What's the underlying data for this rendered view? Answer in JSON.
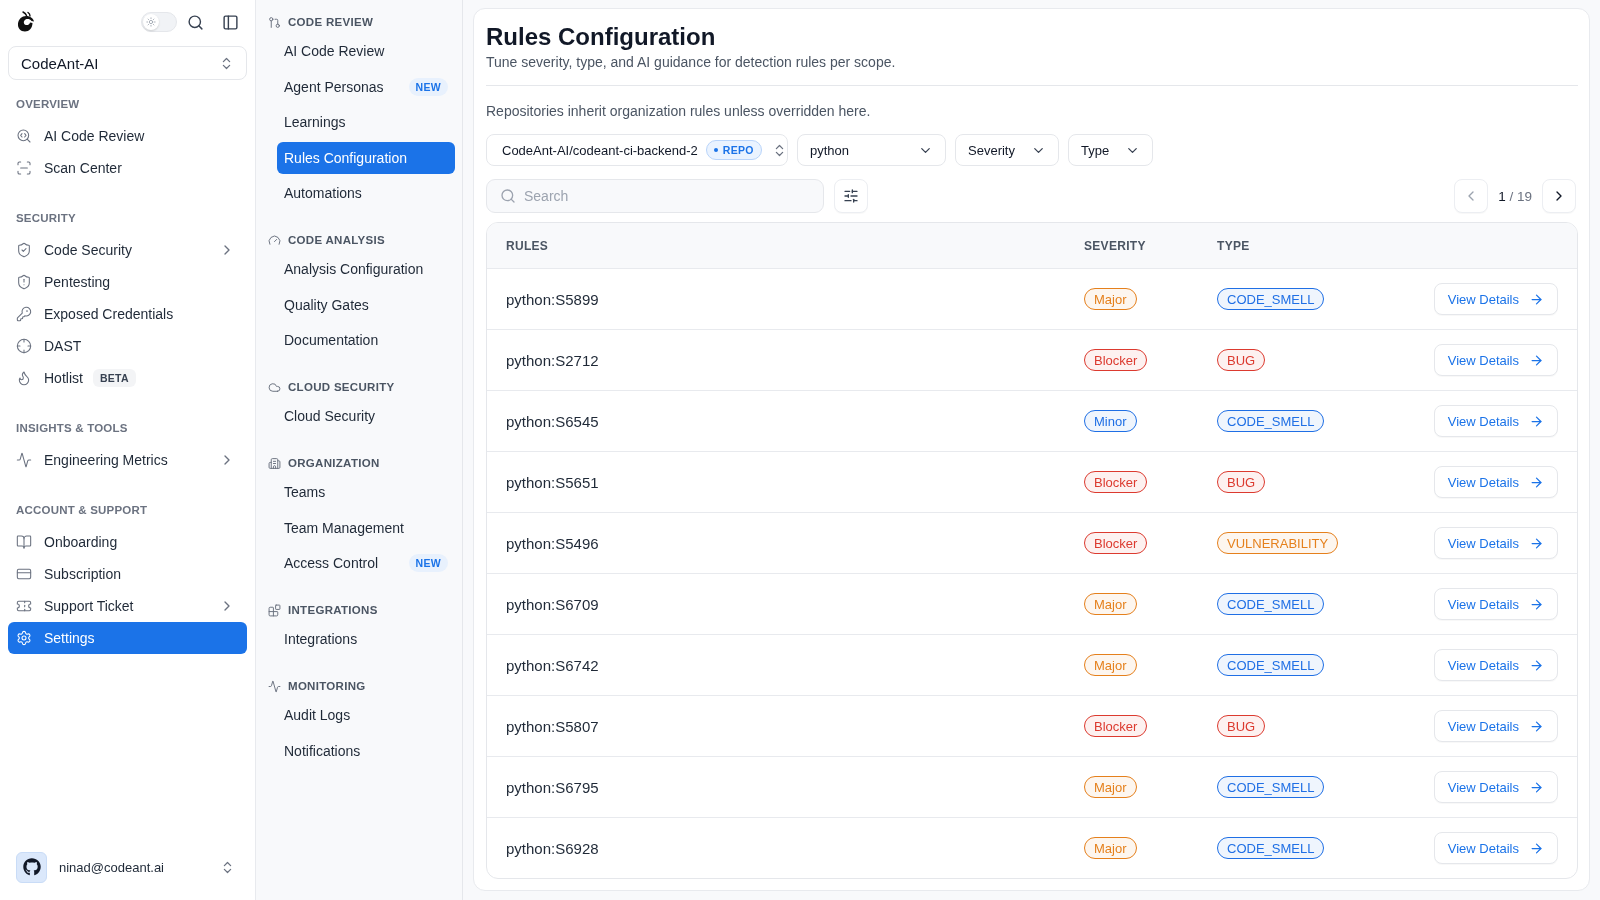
{
  "sidebar": {
    "theme_toggle": {
      "on": false
    },
    "organization": "CodeAnt-AI",
    "sections": [
      {
        "title": "OVERVIEW",
        "items": [
          {
            "label": "AI Code Review",
            "selected": false,
            "expandable": false
          },
          {
            "label": "Scan Center",
            "selected": false,
            "expandable": false
          }
        ]
      },
      {
        "title": "SECURITY",
        "items": [
          {
            "label": "Code Security",
            "selected": false,
            "expandable": true
          },
          {
            "label": "Pentesting",
            "selected": false,
            "expandable": false
          },
          {
            "label": "Exposed Credentials",
            "selected": false,
            "expandable": false
          },
          {
            "label": "DAST",
            "selected": false,
            "expandable": false
          },
          {
            "label": "Hotlist",
            "selected": false,
            "expandable": false,
            "badge": "BETA"
          }
        ]
      },
      {
        "title": "INSIGHTS & TOOLS",
        "items": [
          {
            "label": "Engineering Metrics",
            "selected": false,
            "expandable": true
          }
        ]
      },
      {
        "title": "ACCOUNT & SUPPORT",
        "items": [
          {
            "label": "Onboarding",
            "selected": false,
            "expandable": false
          },
          {
            "label": "Subscription",
            "selected": false,
            "expandable": false
          },
          {
            "label": "Support Ticket",
            "selected": false,
            "expandable": true
          },
          {
            "label": "Settings",
            "selected": true,
            "expandable": false
          }
        ]
      }
    ],
    "user": {
      "email": "ninad@codeant.ai"
    }
  },
  "settings_nav": {
    "sections": [
      {
        "title": "CODE REVIEW",
        "items": [
          {
            "label": "AI Code Review",
            "selected": false
          },
          {
            "label": "Agent Personas",
            "selected": false,
            "badge": "NEW"
          },
          {
            "label": "Learnings",
            "selected": false
          },
          {
            "label": "Rules Configuration",
            "selected": true
          },
          {
            "label": "Automations",
            "selected": false
          }
        ]
      },
      {
        "title": "CODE ANALYSIS",
        "items": [
          {
            "label": "Analysis Configuration",
            "selected": false
          },
          {
            "label": "Quality Gates",
            "selected": false
          },
          {
            "label": "Documentation",
            "selected": false
          }
        ]
      },
      {
        "title": "CLOUD SECURITY",
        "items": [
          {
            "label": "Cloud Security",
            "selected": false
          }
        ]
      },
      {
        "title": "ORGANIZATION",
        "items": [
          {
            "label": "Teams",
            "selected": false
          },
          {
            "label": "Team Management",
            "selected": false
          },
          {
            "label": "Access Control",
            "selected": false,
            "badge": "NEW"
          }
        ]
      },
      {
        "title": "INTEGRATIONS",
        "items": [
          {
            "label": "Integrations",
            "selected": false
          }
        ]
      },
      {
        "title": "MONITORING",
        "items": [
          {
            "label": "Audit Logs",
            "selected": false
          },
          {
            "label": "Notifications",
            "selected": false
          }
        ]
      }
    ]
  },
  "page": {
    "title": "Rules Configuration",
    "subtitle": "Tune severity, type, and AI guidance for detection rules per scope.",
    "note": "Repositories inherit organization rules unless overridden here.",
    "repository": {
      "value": "CodeAnt-AI/codeant-ci-backend-2",
      "badge": "REPO"
    },
    "filters": [
      {
        "label": "python"
      },
      {
        "label": "Severity"
      },
      {
        "label": "Type"
      }
    ],
    "search": {
      "placeholder": "Search"
    },
    "pagination": {
      "current": "1",
      "total": "/ 19",
      "prev_disabled": true
    },
    "table": {
      "columns": [
        "RULES",
        "SEVERITY",
        "TYPE"
      ],
      "rows": [
        {
          "rule": "python:S5899",
          "severity": {
            "label": "Major",
            "color": "#e5801c"
          },
          "type": {
            "label": "CODE_SMELL",
            "color": "#1f6fe5"
          },
          "action": "View Details"
        },
        {
          "rule": "python:S2712",
          "severity": {
            "label": "Blocker",
            "color": "#dc3a2f"
          },
          "type": {
            "label": "BUG",
            "color": "#dc3a2f"
          },
          "action": "View Details"
        },
        {
          "rule": "python:S6545",
          "severity": {
            "label": "Minor",
            "color": "#1f6fe5"
          },
          "type": {
            "label": "CODE_SMELL",
            "color": "#1f6fe5"
          },
          "action": "View Details"
        },
        {
          "rule": "python:S5651",
          "severity": {
            "label": "Blocker",
            "color": "#dc3a2f"
          },
          "type": {
            "label": "BUG",
            "color": "#dc3a2f"
          },
          "action": "View Details"
        },
        {
          "rule": "python:S5496",
          "severity": {
            "label": "Blocker",
            "color": "#dc3a2f"
          },
          "type": {
            "label": "VULNERABILITY",
            "color": "#e5801c"
          },
          "action": "View Details"
        },
        {
          "rule": "python:S6709",
          "severity": {
            "label": "Major",
            "color": "#e5801c"
          },
          "type": {
            "label": "CODE_SMELL",
            "color": "#1f6fe5"
          },
          "action": "View Details"
        },
        {
          "rule": "python:S6742",
          "severity": {
            "label": "Major",
            "color": "#e5801c"
          },
          "type": {
            "label": "CODE_SMELL",
            "color": "#1f6fe5"
          },
          "action": "View Details"
        },
        {
          "rule": "python:S5807",
          "severity": {
            "label": "Blocker",
            "color": "#dc3a2f"
          },
          "type": {
            "label": "BUG",
            "color": "#dc3a2f"
          },
          "action": "View Details"
        },
        {
          "rule": "python:S6795",
          "severity": {
            "label": "Major",
            "color": "#e5801c"
          },
          "type": {
            "label": "CODE_SMELL",
            "color": "#1f6fe5"
          },
          "action": "View Details"
        },
        {
          "rule": "python:S6928",
          "severity": {
            "label": "Major",
            "color": "#e5801c"
          },
          "type": {
            "label": "CODE_SMELL",
            "color": "#1f6fe5"
          },
          "action": "View Details"
        }
      ]
    }
  }
}
